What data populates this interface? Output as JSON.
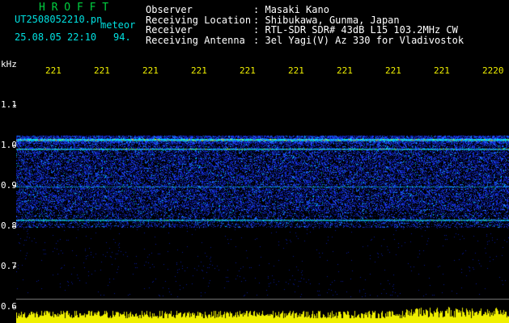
{
  "header": {
    "title": "H R O F F T",
    "filename": "UT2508052210.pn",
    "mode": "meteor",
    "datetime": "25.08.05 22:10",
    "counter": "94.",
    "fields": [
      {
        "label": "Observer",
        "value": "Masaki Kano"
      },
      {
        "label": "Receiving Location",
        "value": "Shibukawa, Gunma, Japan"
      },
      {
        "label": "Receiver",
        "value": "RTL-SDR SDR# 43dB L15 103.2MHz CW"
      },
      {
        "label": "Receiving Antenna",
        "value": "3el Yagi(V) Az 330 for Vladivostok"
      }
    ],
    "separator": ":"
  },
  "axis": {
    "unit": "kHz",
    "time_ticks": [
      "221",
      "221",
      "221",
      "221",
      "221",
      "221",
      "221",
      "221",
      "221",
      "2220"
    ],
    "freq_ticks": [
      "1.1",
      "1.0",
      "0.9",
      "0.8",
      "0.7",
      "0.6"
    ]
  },
  "colors": {
    "background": "#000000",
    "header_text": "#ffffff",
    "meta_text": "#00e0e0",
    "title_text": "#00d040",
    "tick_text": "#f0f000",
    "noise": "#1a3aff",
    "signal": "#00ffff",
    "hot": "#ffff00"
  }
}
